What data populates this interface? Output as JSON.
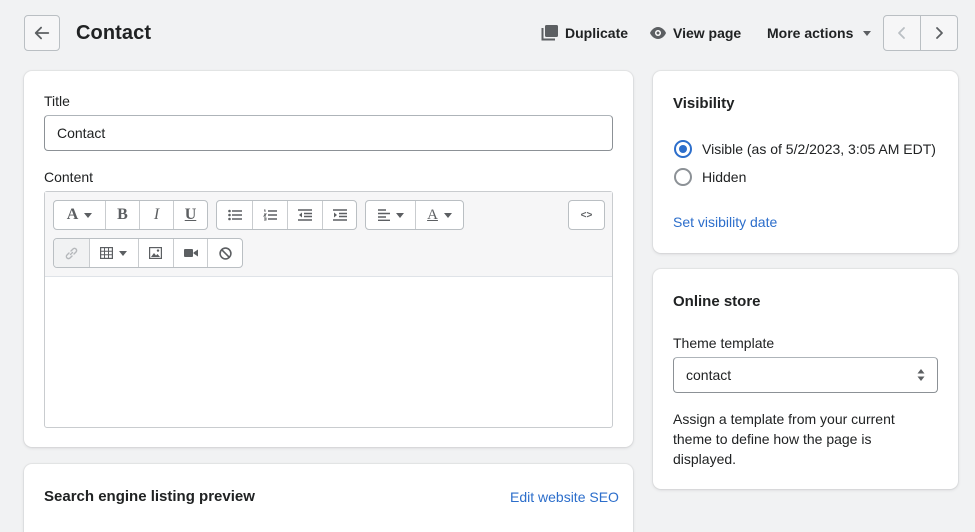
{
  "header": {
    "title": "Contact",
    "actions": {
      "duplicate": "Duplicate",
      "view_page": "View page",
      "more_actions": "More actions"
    },
    "icons": [
      "back-arrow-icon",
      "duplicate-icon",
      "eye-icon",
      "caret-down-icon",
      "chevron-left-icon",
      "chevron-right-icon"
    ]
  },
  "main_card": {
    "title_label": "Title",
    "title_value": "Contact",
    "content_label": "Content",
    "toolbar": {
      "font_letter": "A",
      "bold": "B",
      "italic": "I",
      "underline": "U",
      "color_letter": "A",
      "html_toggle": "<>"
    },
    "content_value": ""
  },
  "seo_card": {
    "title": "Search engine listing preview",
    "edit_link": "Edit website SEO"
  },
  "visibility": {
    "title": "Visibility",
    "options": [
      {
        "label": "Visible (as of 5/2/2023, 3:05 AM EDT)",
        "checked": true
      },
      {
        "label": "Hidden",
        "checked": false
      }
    ],
    "set_date_link": "Set visibility date"
  },
  "online_store": {
    "title": "Online store",
    "template_label": "Theme template",
    "template_value": "contact",
    "help_text": "Assign a template from your current theme to define how the page is displayed."
  },
  "colors": {
    "background": "#f1f2f3",
    "link": "#2c6ecb",
    "radio_checked": "#2c6ecb",
    "text": "#202223"
  }
}
